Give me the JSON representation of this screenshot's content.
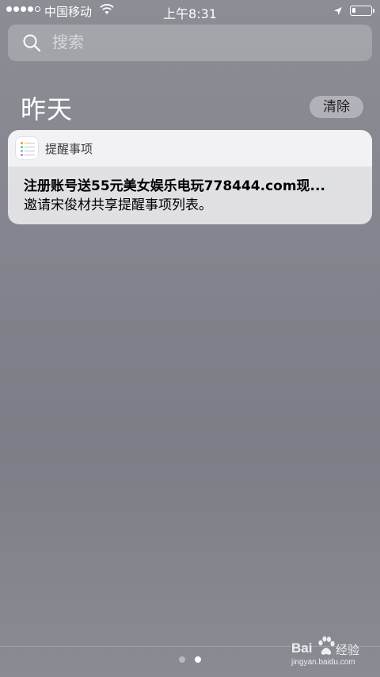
{
  "status_bar": {
    "carrier": "中国移动",
    "time": "上午8:31",
    "signal_bars": 4,
    "signal_total": 5
  },
  "search": {
    "placeholder": "搜索"
  },
  "section": {
    "title": "昨天",
    "clear_label": "清除"
  },
  "notification": {
    "app_name": "提醒事项",
    "title": "注册账号送55元美女娱乐电玩778444.com现...",
    "message": "邀请宋俊材共享提醒事项列表。"
  },
  "page_indicator": {
    "pages": 2,
    "current": 2
  },
  "watermark": {
    "brand": "Bai",
    "suffix": "经验",
    "url": "jingyan.baidu.com"
  }
}
